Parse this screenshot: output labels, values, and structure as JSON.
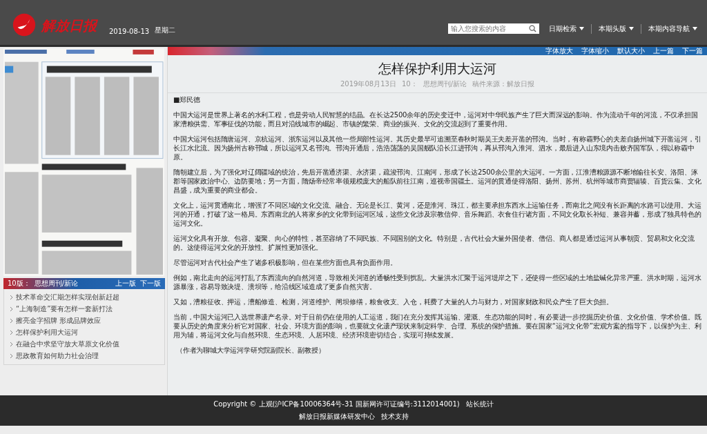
{
  "header": {
    "logo_text": "解放日报",
    "date": "2019-08-13",
    "weekday": "星期二",
    "search": {
      "placeholder": "输入您搜索的内容"
    },
    "nav": [
      {
        "label": "日期检索"
      },
      {
        "label": "本期头版"
      },
      {
        "label": "本期内容导航"
      }
    ]
  },
  "sidebar": {
    "page_bar": {
      "page": "10版：",
      "section": "思想周刊/新论",
      "prev": "上一版",
      "next": "下一版"
    },
    "articles": [
      {
        "title": "技术革命交汇期怎样实现创新赶超"
      },
      {
        "title": "“上海制造”要有怎样一套新打法"
      },
      {
        "title": "擦亮金字招牌 形成品牌效应"
      },
      {
        "title": "怎样保护利用大运河"
      },
      {
        "title": "在融合中求坚守放大草原文化价值"
      },
      {
        "title": "思政教育如何助力社会治理"
      }
    ]
  },
  "toolbar": {
    "font_buttons": [
      "字体放大",
      "字体缩小",
      "默认大小"
    ],
    "prev": "上一篇",
    "next": "下一篇"
  },
  "article": {
    "title": "怎样保护利用大运河",
    "meta": [
      "2019年08月13日",
      "10：",
      "思想周刊/新论",
      "稿件来源：解放日报"
    ],
    "author": "■郑民德",
    "paragraphs": [
      "中国大运河是世界上著名的水利工程，也是劳动人民智慧的结晶。在长达2500余年的历史变迁中，运河对中华民族产生了巨大而深远的影响。作为流动千年的河流，不仅承担国家漕粮供需、军事征伐的功能，而且对沿线城市的崛起、市镇的繁荣、商业的振兴、文化的交流起到了重要作用。",
      "中国大运河包括隋唐运河、京杭运河、浙东运河以及其他一些局部性运河。其历史最早可追溯至春秋时期吴王夫差开凿的邗沟。当时，有称霸野心的夫差自扬州城下开凿运河，引长江水北流。因为扬州古称邗城，所以运河又名邗沟。邗沟开通后，浩浩荡荡的吴国舰队沿长江进邗沟，再从邗沟入淮河、泗水，最后进入山东境内击败齐国军队，得以称霸中原。",
      "隋朝建立后，为了强化对辽阔疆域的统治，先后开凿通济渠、永济渠，疏浚邗沟、江南河，形成了长达2500余公里的大运河。一方面，江淮漕粮源源不断地输往长安、洛阳、涿郡等国家政治中心、边防要地；另一方面，隋炀帝经常率领规模庞大的船队前往江南，巡视帝国疆土。运河的贯通使得洛阳、扬州、苏州、杭州等城市商贾辐辏、百货云集、文化昌盛，成为重要的商业都会。",
      "文化上，运河贯通南北，增强了不同区域的文化交流、融合。无论是长江、黄河，还是淮河、珠江，都主要承担东西水上运输任务，而南北之间没有长距离的水路可以使用。大运河的开通，打破了这一格局。东西南北的人将家乡的文化带到运河区域，这些文化涉及宗教信仰、音乐舞蹈、衣食住行诸方面，不同文化取长补短、兼容并蓄，形成了独具特色的运河文化。",
      "运河文化具有开放、包容、凝聚、向心的特性，甚至容纳了不同民族、不同国别的文化。特别是，古代社会大量外国使者、僧侣、商人都是通过运河从事朝贡、贸易和文化交流的。这使得运河文化的开放性、扩展性更加强化。",
      "尽管运河对古代社会产生了诸多积极影响，但在某些方面也具有负面作用。",
      "例如，南北走向的运河打乱了东西流向的自然河道，导致相关河道的通畅性受到扰乱。大量洪水汇聚于运河堤岸之下，还使得一些区域的土地盐碱化异常严重。洪水时期，运河水源暴涨，容易导致决堤、溃坝等，给沿线区域造成了更多自然灾害。",
      "又如，漕粮征收、押运，漕船修造、检测，河道维护、闸坝修缮，粮食收支、入仓，耗费了大量的人力与财力，对国家财政和民众产生了巨大负担。",
      "当前，中国大运河已入选世界遗产名录。对于目前仍在使用的人工运道，我们在充分发挥其运输、灌溉、生态功能的同时，有必要进一步挖掘历史价值、文化价值、学术价值。既要从历史的角度来分析它对国家、社会、环境方面的影响，也要就文化遗产现状来制定科学、合理、系统的保护措施。要在国家“运河文化带”宏观方案的指导下，以保护为主、利用为辅，将运河文化与自然环境、生态环境、人居环境、经济环境密切结合，实现可持续发展。"
    ],
    "note": "（作者为聊城大学运河学研究院副院长、副教授）"
  },
  "footer": {
    "copyright": "Copyright © 上观(沪ICP备10006364号-31 国新网许可证编号:3112014001)",
    "stats": "站长统计",
    "center": "解放日报新媒体研发中心",
    "support": "技术支持"
  }
}
